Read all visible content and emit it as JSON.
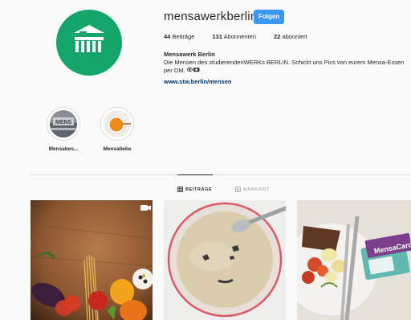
{
  "profile": {
    "username": "mensawerkberlin",
    "follow_label": "Folgen",
    "stats": [
      {
        "count": "44",
        "label": "Beiträge"
      },
      {
        "count": "131",
        "label": "Abonnenten"
      },
      {
        "count": "22",
        "label": "abonniert"
      }
    ],
    "full_name": "Mensawerk Berlin",
    "bio": "Die Mensen des studierendenWERKs BERLIN. Schickt uns Pics von eurem Mensa-Essen per DM.",
    "website": "www.stw.berlin/mensen"
  },
  "highlights": [
    {
      "label": "Mensabes..."
    },
    {
      "label": "Mensaliebe"
    }
  ],
  "tabs": [
    {
      "label": "BEITRÄGE",
      "active": true
    },
    {
      "label": "MARKIERT",
      "active": false
    }
  ],
  "posts": [
    {
      "description": "vegetables-on-wood",
      "badge_icon": "video-icon"
    },
    {
      "description": "bowl-of-soup-with-face"
    },
    {
      "description": "plate-with-potatoes-and-mensacard",
      "card_text": "MensaCard"
    }
  ],
  "colors": {
    "brand_green": "#14a56a",
    "follow_blue": "#3897f0",
    "link_blue": "#003569"
  }
}
